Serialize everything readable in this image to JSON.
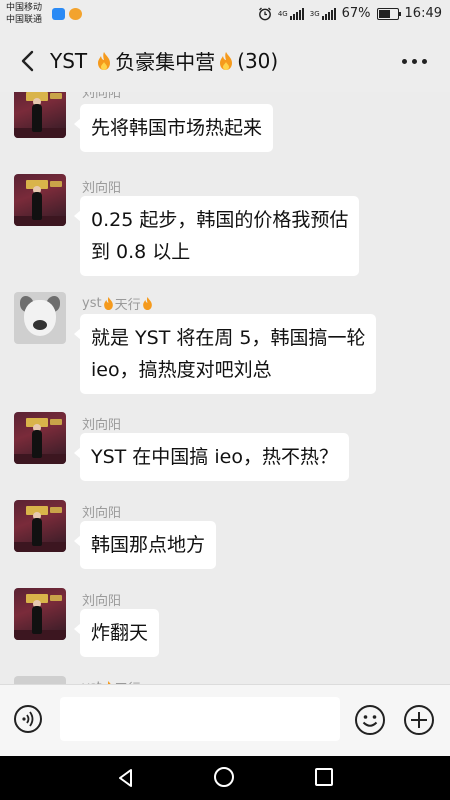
{
  "status_bar": {
    "carrier_1": "中国移动",
    "carrier_2": "中国联通",
    "network_1": "4G",
    "network_2": "3G",
    "battery": "67%",
    "battery_level": 0.67,
    "time": "16:49"
  },
  "header": {
    "title_prefix": "YST",
    "title_main": "负豪集中营",
    "member_count": "(30)",
    "back_icon": "chevron-left-icon",
    "more_icon": "more-dots-icon"
  },
  "messages": [
    {
      "sender": "刘向阳",
      "text": "先将韩国市场热起来",
      "avatar": "liu"
    },
    {
      "sender": "刘向阳",
      "text": "0.25 起步，韩国的价格我预估\n到 0.8 以上",
      "avatar": "liu"
    },
    {
      "sender_prefix": "yst",
      "sender": "天行",
      "text": "就是 YST 将在周 5，韩国搞一轮\nieo，搞热度对吧刘总",
      "avatar": "dog"
    },
    {
      "sender": "刘向阳",
      "text": "YST 在中国搞 ieo，热不热？",
      "avatar": "liu"
    },
    {
      "sender": "刘向阳",
      "text": "韩国那点地方",
      "avatar": "liu"
    },
    {
      "sender": "刘向阳",
      "text": "炸翻天",
      "avatar": "liu"
    },
    {
      "sender_prefix": "yst",
      "sender": "天行",
      "avatar": "partial"
    }
  ],
  "input_bar": {
    "text_value": "",
    "voice_icon": "voice-icon",
    "emoji_icon": "emoji-icon",
    "plus_icon": "plus-icon"
  },
  "colors": {
    "background": "#ececec",
    "bubble": "#ffffff",
    "sender_name": "#9a9a9a",
    "fire": "#f59a1c"
  }
}
